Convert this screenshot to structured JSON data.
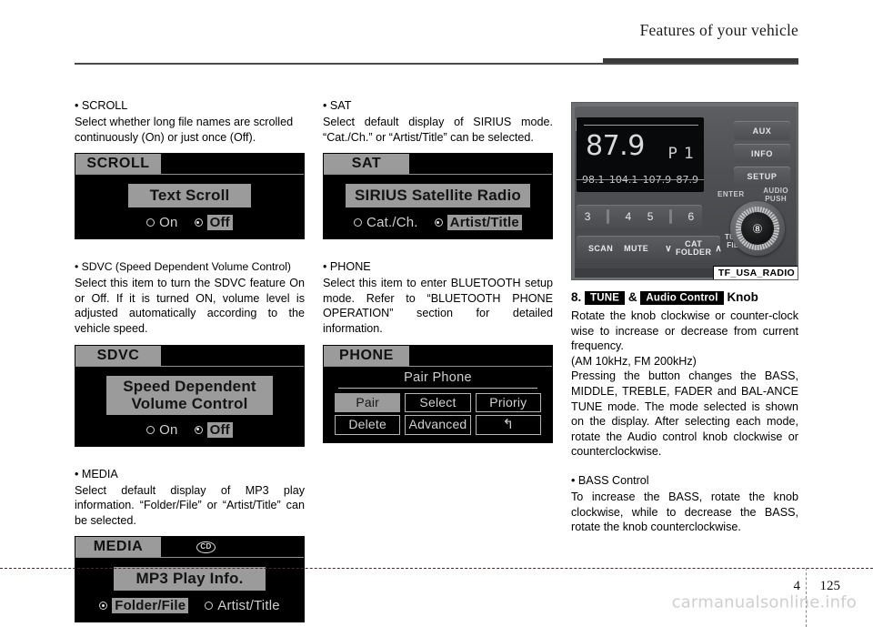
{
  "header": {
    "title": "Features of your vehicle"
  },
  "footer": {
    "chapter": "4",
    "page": "125",
    "watermark": "carmanualsonline.info"
  },
  "column_left": {
    "scroll": {
      "heading": "• SCROLL",
      "body": "Select whether long file names are scrolled continuously (On) or just once (Off).",
      "screen": {
        "tab": "SCROLL",
        "button": "Text Scroll",
        "options": [
          {
            "label": "On",
            "selected": false
          },
          {
            "label": "Off",
            "selected": true
          }
        ]
      }
    },
    "sdvc": {
      "heading": "• SDVC (Speed Dependent Volume Control)",
      "body": "Select this item to turn the SDVC feature On or Off. If it is turned ON, volume level is adjusted automatically according to the vehicle speed.",
      "screen": {
        "tab": "SDVC",
        "button_line1": "Speed Dependent",
        "button_line2": "Volume Control",
        "options": [
          {
            "label": "On",
            "selected": false
          },
          {
            "label": "Off",
            "selected": true
          }
        ]
      }
    },
    "media": {
      "heading": "• MEDIA",
      "body": "Select default display of MP3 play information. “Folder/File” or “Artist/Title” can be selected.",
      "screen": {
        "tab": "MEDIA",
        "badge": "CD",
        "button": "MP3 Play Info.",
        "options": [
          {
            "label": "Folder/File",
            "selected": true
          },
          {
            "label": "Artist/Title",
            "selected": false
          }
        ]
      }
    }
  },
  "column_middle": {
    "sat": {
      "heading": "• SAT",
      "body": "Select default display of SIRIUS mode. “Cat./Ch.” or “Artist/Title” can be selected.",
      "screen": {
        "tab": "SAT",
        "button": "SIRIUS Satellite Radio",
        "options": [
          {
            "label": "Cat./Ch.",
            "selected": false
          },
          {
            "label": "Artist/Title",
            "selected": true
          }
        ]
      }
    },
    "phone": {
      "heading": "• PHONE",
      "body": "Select this item to enter BLUETOOTH setup mode. Refer to “BLUETOOTH PHONE OPERATION” section for detailed information.",
      "screen": {
        "tab": "PHONE",
        "title": "Pair Phone",
        "buttons": [
          {
            "label": "Pair",
            "selected": true
          },
          {
            "label": "Select",
            "selected": false
          },
          {
            "label": "Prioriy",
            "selected": false
          },
          {
            "label": "Delete",
            "selected": false
          },
          {
            "label": "Advanced",
            "selected": false
          },
          {
            "label": "↰",
            "selected": false
          }
        ]
      }
    }
  },
  "column_right": {
    "radio_photo": {
      "caption": "TF_USA_RADIO",
      "display": {
        "frequency": "87.9",
        "preset_indicator": "P 1",
        "presets": [
          "98.1",
          "104.1",
          "107.9",
          "87.9"
        ]
      },
      "preset_buttons": [
        "3",
        "4",
        "5",
        "6"
      ],
      "side_buttons": [
        "AUX",
        "INFO",
        "SETUP"
      ],
      "enter_label": "ENTER",
      "audio_label_line1": "AUDIO",
      "audio_label_line2": "PUSH",
      "scan_label": "SCAN",
      "mute_label": "MUTE",
      "cat_label": "CAT",
      "folder_label": "FOLDER",
      "chevron_down": "∨",
      "chevron_up": "∧",
      "tune_label": "TUNE",
      "file_label": "FILE",
      "knob_callout": "⑧"
    },
    "section": {
      "number": "8.",
      "badge_tune": "TUNE",
      "ampersand": "&",
      "badge_audio": "Audio Control",
      "knob_word": "Knob",
      "para1": "Rotate the knob clockwise or counter-clock wise to increase or decrease from current frequency.",
      "para2": "(AM 10kHz, FM 200kHz)",
      "para3": "Pressing the button changes the BASS, MIDDLE, TREBLE, FADER and BAL-ANCE TUNE mode. The mode selected is shown on the display. After selecting each mode, rotate the Audio control knob clockwise or counterclockwise.",
      "bass_heading": "• BASS Control",
      "bass_body": "To increase the BASS, rotate the knob clockwise, while to decrease the BASS, rotate the knob counterclockwise."
    }
  }
}
